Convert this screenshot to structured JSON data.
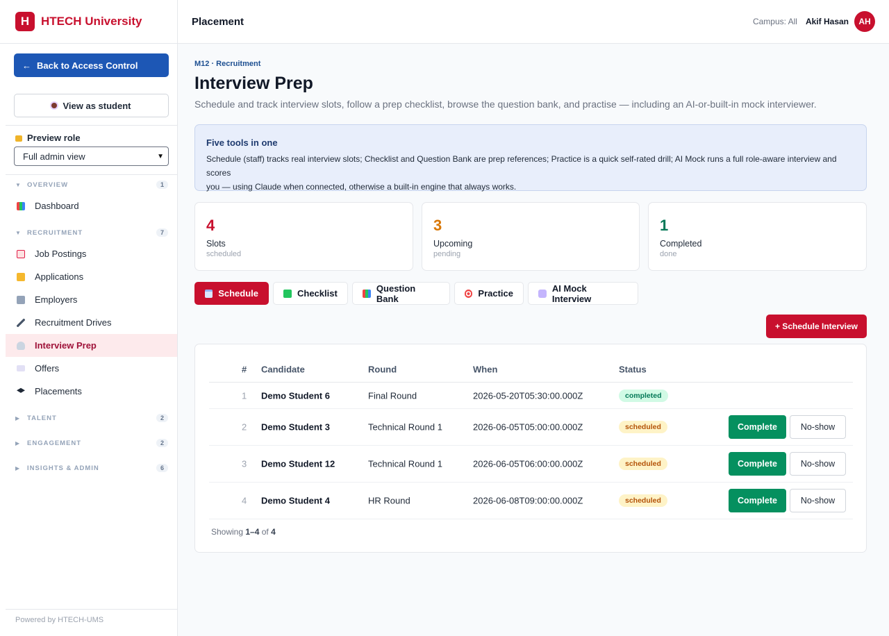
{
  "brand": {
    "logo_letter": "H",
    "name": "HTECH University",
    "color": "#c8102e"
  },
  "sidebar": {
    "back_label": "Back to Access Control",
    "back_arrow": "←",
    "view_student_label": "View as student",
    "preview_role_label": "Preview role",
    "preview_role_value": "Full admin view",
    "sections": {
      "overview": {
        "label": "OVERVIEW",
        "count": "1"
      },
      "recruitment": {
        "label": "RECRUITMENT",
        "count": "7"
      },
      "talent": {
        "label": "TALENT",
        "count": "2"
      },
      "engagement": {
        "label": "ENGAGEMENT",
        "count": "2"
      },
      "insights": {
        "label": "INSIGHTS & ADMIN",
        "count": "6"
      }
    },
    "items": {
      "dashboard": "Dashboard",
      "job_postings": "Job Postings",
      "applications": "Applications",
      "employers": "Employers",
      "recruitment_drives": "Recruitment Drives",
      "interview_prep": "Interview Prep",
      "offers": "Offers",
      "placements": "Placements"
    },
    "footer": "Powered by HTECH-UMS"
  },
  "header": {
    "title": "Placement",
    "campus": "Campus: All",
    "user_name": "Akif Hasan",
    "avatar_initials": "AH"
  },
  "main": {
    "breadcrumb": "M12 · Recruitment",
    "title": "Interview Prep",
    "subtitle": "Schedule and track interview slots, follow a prep checklist, browse the question bank, and practise — including an AI-or-built-in mock interviewer.",
    "info": {
      "title": "Five tools in one",
      "line1": "Schedule (staff) tracks real interview slots; Checklist and Question Bank are prep references; Practice is a quick self-rated drill; AI Mock runs a full role-aware interview and scores",
      "line2": "you — using Claude when connected, otherwise a built-in engine that always works."
    },
    "stats": [
      {
        "value": "4",
        "label": "Slots",
        "sub": "scheduled",
        "color": "#c8102e"
      },
      {
        "value": "3",
        "label": "Upcoming",
        "sub": "pending",
        "color": "#d97706"
      },
      {
        "value": "1",
        "label": "Completed",
        "sub": "done",
        "color": "#047857"
      }
    ],
    "tabs": {
      "schedule": "Schedule",
      "checklist": "Checklist",
      "question_bank": "Question Bank",
      "practice": "Practice",
      "ai_mock": "AI Mock Interview"
    },
    "schedule_button": "+ Schedule Interview",
    "table": {
      "headers": {
        "num": "#",
        "candidate": "Candidate",
        "round": "Round",
        "when": "When",
        "status": "Status"
      },
      "rows": [
        {
          "num": "1",
          "candidate": "Demo Student 6",
          "round": "Final Round",
          "when": "2026-05-20T05:30:00.000Z",
          "status": "completed"
        },
        {
          "num": "2",
          "candidate": "Demo Student 3",
          "round": "Technical Round 1",
          "when": "2026-06-05T05:00:00.000Z",
          "status": "scheduled"
        },
        {
          "num": "3",
          "candidate": "Demo Student 12",
          "round": "Technical Round 1",
          "when": "2026-06-05T06:00:00.000Z",
          "status": "scheduled"
        },
        {
          "num": "4",
          "candidate": "Demo Student 4",
          "round": "HR Round",
          "when": "2026-06-08T09:00:00.000Z",
          "status": "scheduled"
        }
      ],
      "complete_label": "Complete",
      "noshow_label": "No-show",
      "showing_prefix": "Showing",
      "showing_range": "1–4",
      "showing_of": "of",
      "showing_total": "4"
    }
  }
}
